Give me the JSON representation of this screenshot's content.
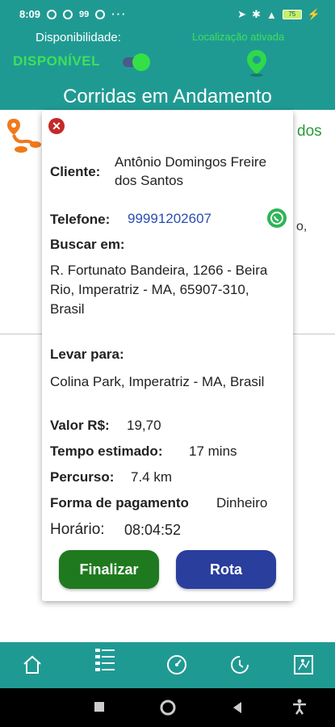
{
  "status_bar": {
    "time": "8:09",
    "badge": "99",
    "battery": "75"
  },
  "header": {
    "availability_label": "Disponibilidade:",
    "availability_status": "DISPONÍVEL",
    "location_label": "Localização ativada",
    "title": "Corridas em Andamento"
  },
  "background_list": {
    "visible_text_1": "dos",
    "visible_text_2": "o,"
  },
  "ride": {
    "client_label": "Cliente:",
    "client_value": "Antônio Domingos Freire dos Santos",
    "phone_label": "Telefone:",
    "phone_value": "99991202607",
    "pickup_label": "Buscar em:",
    "pickup_value": "R. Fortunato Bandeira, 1266 - Beira Rio, Imperatriz - MA, 65907-310, Brasil",
    "dest_label": "Levar para:",
    "dest_value": "Colina Park, Imperatriz  -  MA, Brasil",
    "price_label": "Valor R$:",
    "price_value": "19,70",
    "time_label": "Tempo estimado:",
    "time_value": "17 mins",
    "distance_label": "Percurso:",
    "distance_value": "7.4 km",
    "payment_label": "Forma de pagamento",
    "payment_value": "Dinheiro",
    "schedule_label": "Horário:",
    "schedule_value": "08:04:52"
  },
  "actions": {
    "finish_label": "Finalizar",
    "route_label": "Rota"
  },
  "nav_icons": [
    "home-icon",
    "list-icon",
    "speedometer-icon",
    "history-icon",
    "map-icon"
  ],
  "colors": {
    "primary": "#1f9a93",
    "available_green": "#3fe05a",
    "finish_button": "#1f7a1f",
    "route_button": "#2a3e9e",
    "close_red": "#c62828",
    "phone_link": "#2a4cb0"
  }
}
